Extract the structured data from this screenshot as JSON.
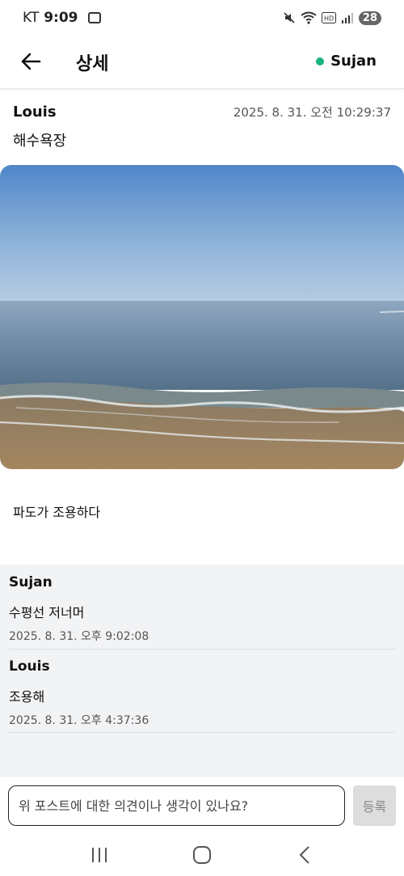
{
  "status_bar": {
    "carrier": "KT",
    "time": "9:09",
    "battery": "28"
  },
  "app_bar": {
    "title": "상세",
    "user": "Sujan",
    "online_color": "#19b57c"
  },
  "post": {
    "author": "Louis",
    "timestamp": "2025. 8. 31. 오전 10:29:37",
    "title": "해수욕장",
    "image_icon": "beach-photo",
    "body": "파도가 조용하다"
  },
  "comments": [
    {
      "author": "Sujan",
      "text": "수평선 저너머",
      "timestamp": "2025. 8. 31. 오후 9:02:08"
    },
    {
      "author": "Louis",
      "text": "조용해",
      "timestamp": "2025. 8. 31. 오후 4:37:36"
    }
  ],
  "comment_input": {
    "placeholder": "위 포스트에 대한 의견이나 생각이 있나요?",
    "value": ""
  },
  "submit_label": "등록"
}
